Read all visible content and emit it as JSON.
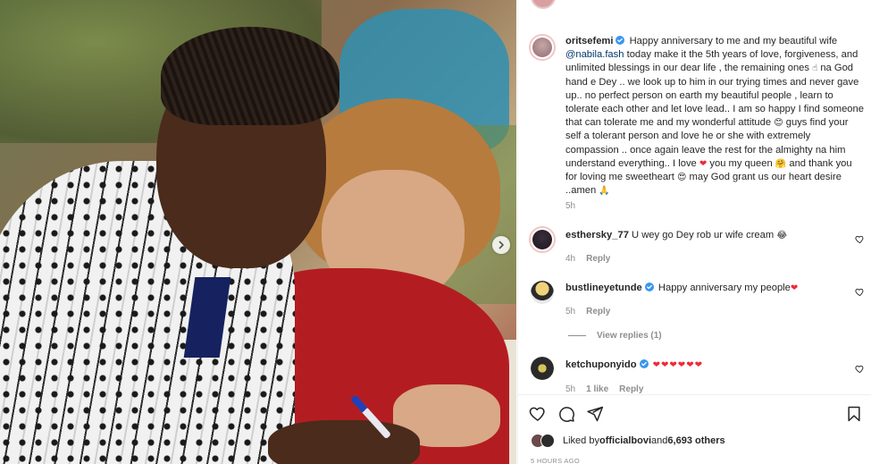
{
  "post": {
    "author": "oritsefemi",
    "caption_parts": [
      "Happy anniversary to me and my beautiful wife ",
      "@nabila.fash",
      " today make it the 5th years of love, forgiveness, and unlimited blessings in our dear life , the remaining ones ",
      " na God hand e Dey .. we look up to him in our trying times and never gave up.. no perfect person on earth my beautiful people , learn to tolerate each other and let love lead.. I am so happy I find someone that can tolerate me and my wonderful attitude ",
      " guys find your self a tolerant person and love he or she with extremely compassion .. once again leave the rest for the almighty na him understand everything.. I love ",
      " you my queen ",
      " and thank you for loving me sweetheart ",
      " may God grant us our heart desire ..amen "
    ],
    "caption_emojis": [
      "☝",
      "😊",
      "❤",
      "🤗",
      "😍",
      "🙏"
    ],
    "caption_time": "5h"
  },
  "comments": [
    {
      "username": "esthersky_77",
      "text": "U wey go Dey rob ur wife cream",
      "emoji": "😂",
      "time": "4h",
      "reply": "Reply",
      "verified": false
    },
    {
      "username": "bustlineyetunde",
      "text": "Happy anniversary my people",
      "emoji": "❤",
      "time": "5h",
      "reply": "Reply",
      "verified": true
    },
    {
      "username": "ketchuponyido",
      "text": "",
      "emoji": "❤❤❤❤❤❤",
      "time": "5h",
      "likes": "1 like",
      "reply": "Reply",
      "verified": true
    }
  ],
  "view_replies": "View replies (1)",
  "likes": {
    "prefix": "Liked by ",
    "user": "officialbovi",
    "suffix": " and ",
    "others": "6,693 others"
  },
  "post_time": "5 HOURS AGO",
  "icons": {
    "like": "heart-outline-icon",
    "comment": "comment-bubble-icon",
    "share": "paper-plane-icon",
    "save": "bookmark-icon",
    "next": "chevron-right-icon",
    "verified": "verified-badge-icon"
  },
  "colors": {
    "verified": "#3897f0",
    "mention": "#00376b",
    "muted": "#8e8e8e",
    "heart": "#ed2a3a"
  }
}
